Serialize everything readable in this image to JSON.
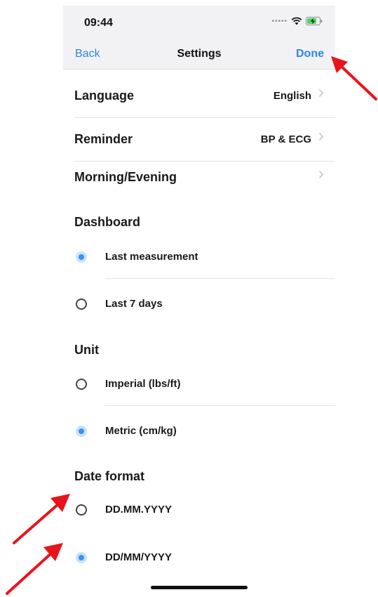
{
  "status": {
    "time": "09:44"
  },
  "nav": {
    "back": "Back",
    "title": "Settings",
    "done": "Done"
  },
  "rows": [
    {
      "label": "Language",
      "value": "English"
    },
    {
      "label": "Reminder",
      "value": "BP & ECG"
    },
    {
      "label": "Morning/Evening",
      "value": ""
    }
  ],
  "sections": {
    "dashboard": {
      "title": "Dashboard",
      "options": [
        {
          "label": "Last measurement",
          "selected": true
        },
        {
          "label": "Last 7 days",
          "selected": false
        }
      ]
    },
    "unit": {
      "title": "Unit",
      "options": [
        {
          "label": "Imperial (lbs/ft)",
          "selected": false
        },
        {
          "label": "Metric (cm/kg)",
          "selected": true
        }
      ]
    },
    "date_format": {
      "title": "Date format",
      "options": [
        {
          "label": "DD.MM.YYYY",
          "selected": false
        },
        {
          "label": "DD/MM/YYYY",
          "selected": true
        }
      ]
    }
  },
  "colors": {
    "accent": "#2e86de",
    "annotation": "#e8141b"
  },
  "icons": [
    "wifi-icon",
    "battery-charging-icon",
    "chevron-right-icon",
    "annotation-arrow"
  ]
}
